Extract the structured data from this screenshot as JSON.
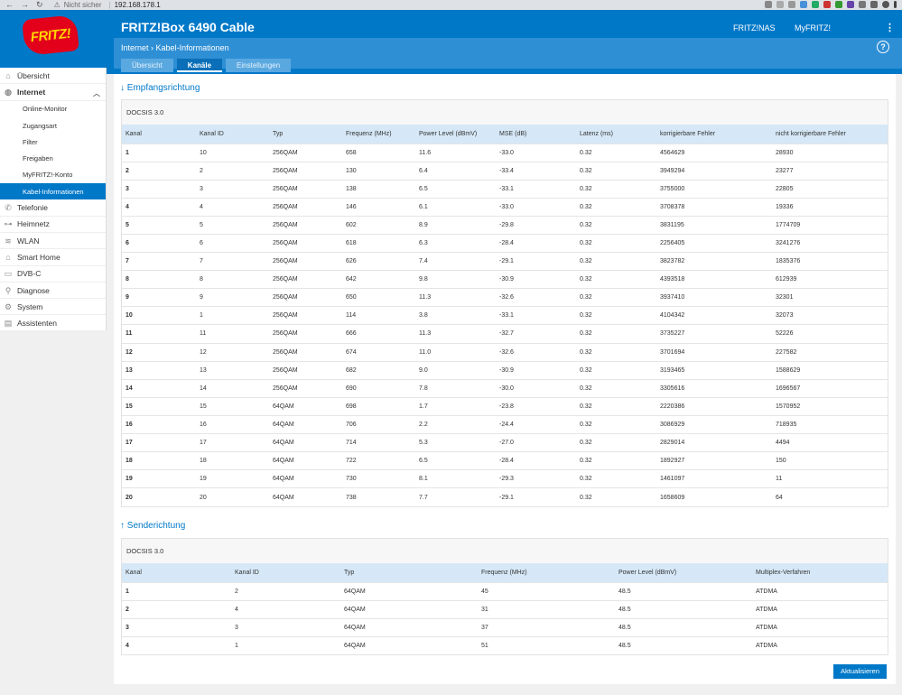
{
  "browser": {
    "security": "Nicht sicher",
    "url": "192.168.178.1"
  },
  "header": {
    "logo_text": "FRITZ!",
    "product": "FRITZ!Box 6490 Cable",
    "links": [
      "FRITZ!NAS",
      "MyFRITZ!"
    ],
    "breadcrumb": [
      "Internet",
      "Kabel-Informationen"
    ],
    "tabs": [
      {
        "label": "Übersicht",
        "active": false
      },
      {
        "label": "Kanäle",
        "active": true
      },
      {
        "label": "Einstellungen",
        "active": false
      }
    ]
  },
  "sidebar": {
    "items": [
      {
        "label": "Übersicht",
        "icon": "home-icon"
      },
      {
        "label": "Internet",
        "icon": "globe-icon",
        "open": true,
        "children": [
          {
            "label": "Online-Monitor"
          },
          {
            "label": "Zugangsart"
          },
          {
            "label": "Filter"
          },
          {
            "label": "Freigaben"
          },
          {
            "label": "MyFRITZ!-Konto"
          },
          {
            "label": "Kabel-Informationen",
            "active": true
          }
        ]
      },
      {
        "label": "Telefonie",
        "icon": "phone-icon"
      },
      {
        "label": "Heimnetz",
        "icon": "network-icon"
      },
      {
        "label": "WLAN",
        "icon": "wifi-icon"
      },
      {
        "label": "Smart Home",
        "icon": "smart-home-icon"
      },
      {
        "label": "DVB-C",
        "icon": "tv-icon"
      },
      {
        "label": "Diagnose",
        "icon": "diagnose-icon"
      },
      {
        "label": "System",
        "icon": "gear-icon"
      },
      {
        "label": "Assistenten",
        "icon": "wizard-icon"
      }
    ]
  },
  "downstream": {
    "heading": "↓ Empfangsrichtung",
    "panel_title": "DOCSIS 3.0",
    "columns": [
      "Kanal",
      "Kanal ID",
      "Typ",
      "Frequenz (MHz)",
      "Power Level (dBmV)",
      "MSE (dB)",
      "Latenz (ms)",
      "korrigierbare Fehler",
      "nicht korrigierbare Fehler"
    ],
    "rows": [
      [
        "1",
        "10",
        "256QAM",
        "658",
        "11.6",
        "-33.0",
        "0.32",
        "4564629",
        "28930"
      ],
      [
        "2",
        "2",
        "256QAM",
        "130",
        "6.4",
        "-33.4",
        "0.32",
        "3949294",
        "23277"
      ],
      [
        "3",
        "3",
        "256QAM",
        "138",
        "6.5",
        "-33.1",
        "0.32",
        "3755000",
        "22805"
      ],
      [
        "4",
        "4",
        "256QAM",
        "146",
        "6.1",
        "-33.0",
        "0.32",
        "3708378",
        "19336"
      ],
      [
        "5",
        "5",
        "256QAM",
        "602",
        "8.9",
        "-29.8",
        "0.32",
        "3831195",
        "1774709"
      ],
      [
        "6",
        "6",
        "256QAM",
        "618",
        "6.3",
        "-28.4",
        "0.32",
        "2256405",
        "3241276"
      ],
      [
        "7",
        "7",
        "256QAM",
        "626",
        "7.4",
        "-29.1",
        "0.32",
        "3823782",
        "1835376"
      ],
      [
        "8",
        "8",
        "256QAM",
        "642",
        "9.8",
        "-30.9",
        "0.32",
        "4393518",
        "612939"
      ],
      [
        "9",
        "9",
        "256QAM",
        "650",
        "11.3",
        "-32.6",
        "0.32",
        "3937410",
        "32301"
      ],
      [
        "10",
        "1",
        "256QAM",
        "114",
        "3.8",
        "-33.1",
        "0.32",
        "4104342",
        "32073"
      ],
      [
        "11",
        "11",
        "256QAM",
        "666",
        "11.3",
        "-32.7",
        "0.32",
        "3735227",
        "52226"
      ],
      [
        "12",
        "12",
        "256QAM",
        "674",
        "11.0",
        "-32.6",
        "0.32",
        "3701694",
        "227582"
      ],
      [
        "13",
        "13",
        "256QAM",
        "682",
        "9.0",
        "-30.9",
        "0.32",
        "3193465",
        "1588629"
      ],
      [
        "14",
        "14",
        "256QAM",
        "690",
        "7.8",
        "-30.0",
        "0.32",
        "3305616",
        "1696567"
      ],
      [
        "15",
        "15",
        "64QAM",
        "698",
        "1.7",
        "-23.8",
        "0.32",
        "2220386",
        "1570952"
      ],
      [
        "16",
        "16",
        "64QAM",
        "706",
        "2.2",
        "-24.4",
        "0.32",
        "3086929",
        "718935"
      ],
      [
        "17",
        "17",
        "64QAM",
        "714",
        "5.3",
        "-27.0",
        "0.32",
        "2829014",
        "4494"
      ],
      [
        "18",
        "18",
        "64QAM",
        "722",
        "6.5",
        "-28.4",
        "0.32",
        "1892927",
        "150"
      ],
      [
        "19",
        "19",
        "64QAM",
        "730",
        "8.1",
        "-29.3",
        "0.32",
        "1461097",
        "11"
      ],
      [
        "20",
        "20",
        "64QAM",
        "738",
        "7.7",
        "-29.1",
        "0.32",
        "1658609",
        "64"
      ]
    ]
  },
  "upstream": {
    "heading": "↑ Senderichtung",
    "panel_title": "DOCSIS 3.0",
    "columns": [
      "Kanal",
      "Kanal ID",
      "Typ",
      "Frequenz (MHz)",
      "Power Level (dBmV)",
      "Multiplex-Verfahren"
    ],
    "rows": [
      [
        "1",
        "2",
        "64QAM",
        "45",
        "48.5",
        "ATDMA"
      ],
      [
        "2",
        "4",
        "64QAM",
        "31",
        "48.5",
        "ATDMA"
      ],
      [
        "3",
        "3",
        "64QAM",
        "37",
        "48.5",
        "ATDMA"
      ],
      [
        "4",
        "1",
        "64QAM",
        "51",
        "48.5",
        "ATDMA"
      ]
    ]
  },
  "actions": {
    "refresh_label": "Aktualisieren"
  },
  "colors": {
    "brand_blue": "#0078c8",
    "header_light": "#d6e8f7",
    "logo_red": "#e2001a"
  }
}
